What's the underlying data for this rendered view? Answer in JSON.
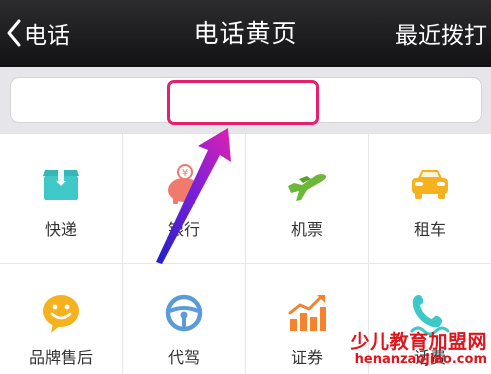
{
  "nav": {
    "back_label": "电话",
    "title": "电话黄页",
    "right_label": "最近拨打"
  },
  "search": {
    "placeholder": ""
  },
  "categories": [
    {
      "label": "快递",
      "icon": "package-icon",
      "color": "#3fc8c8"
    },
    {
      "label": "银行",
      "icon": "piggy-bank-icon",
      "color": "#f07a6e"
    },
    {
      "label": "机票",
      "icon": "airplane-icon",
      "color": "#6cb83a"
    },
    {
      "label": "租车",
      "icon": "car-icon",
      "color": "#f5b21e"
    },
    {
      "label": "品牌售后",
      "icon": "smiley-chat-icon",
      "color": "#f5b21e"
    },
    {
      "label": "代驾",
      "icon": "steering-wheel-icon",
      "color": "#5b9bd8"
    },
    {
      "label": "证券",
      "icon": "stock-chart-icon",
      "color": "#f5832b"
    },
    {
      "label": "话费",
      "icon": "phone-icon",
      "color": "#3fc8c8"
    }
  ],
  "annotation": {
    "highlight_color": "#e6206e"
  },
  "watermark": {
    "line1": "少儿教育加盟网",
    "line2": "henanzaojiao.com"
  }
}
